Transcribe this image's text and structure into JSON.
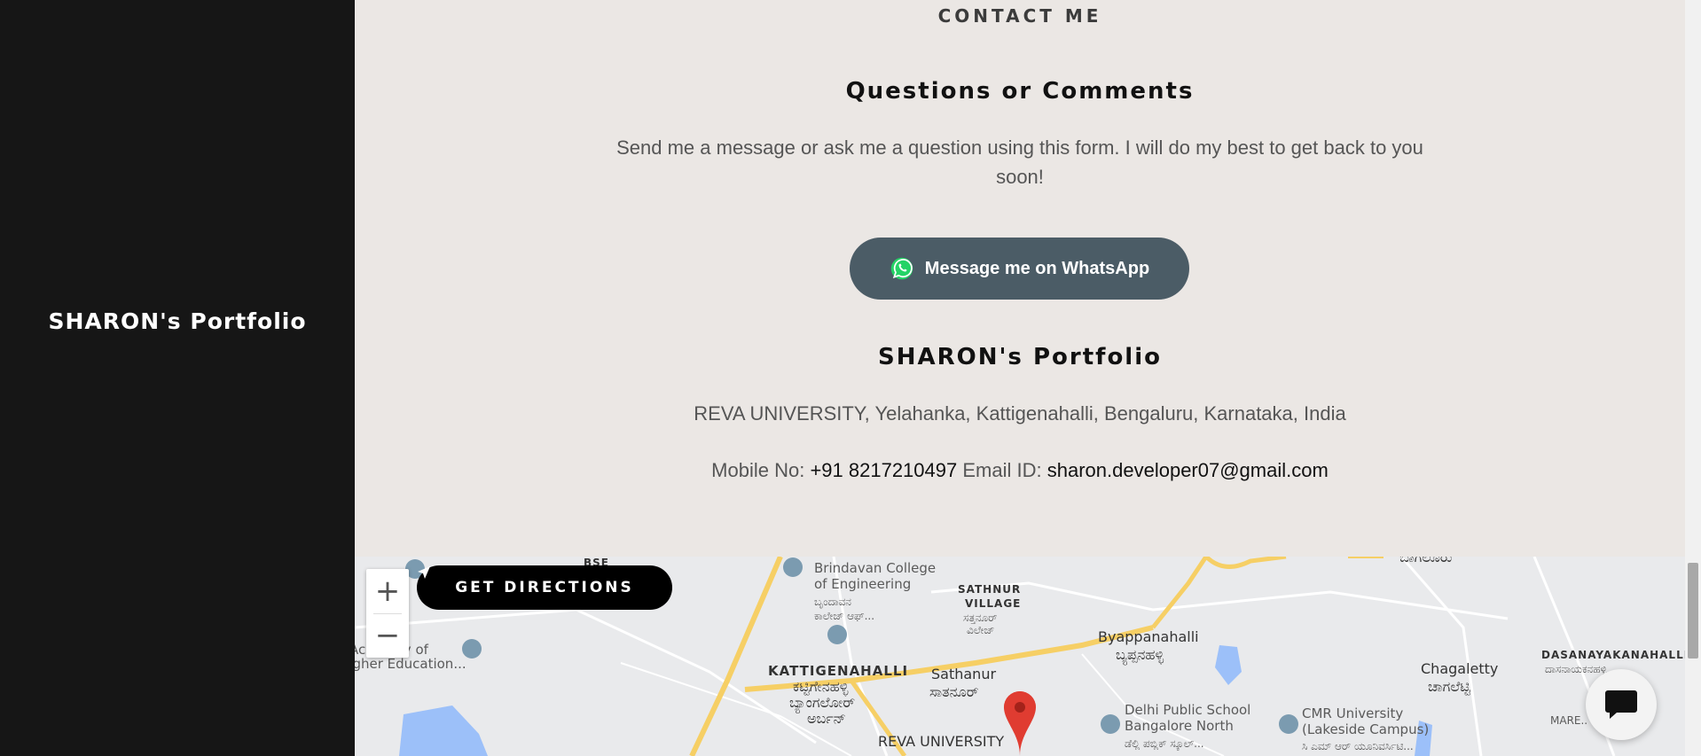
{
  "sidebar": {
    "brand": "SHARON's Portfolio"
  },
  "contact": {
    "section_label": "CONTACT ME",
    "heading": "Questions or Comments",
    "description": "Send me a message or ask me a question using this form. I will do my best to get back to you soon!",
    "whatsapp_label": "Message me on WhatsApp",
    "business_name": "SHARON's Portfolio",
    "address": "REVA UNIVERSITY, Yelahanka, Kattigenahalli, Bengaluru, Karnataka, India",
    "mobile_label": "Mobile No:",
    "mobile_value": "+91 8217210497",
    "email_label": "Email ID:",
    "email_value": "sharon.developer07@gmail.com"
  },
  "map": {
    "zoom_in": "+",
    "zoom_out": "−",
    "directions_label": "GET DIRECTIONS",
    "labels": {
      "bse": "BSE",
      "brindavan_1": "Brindavan College",
      "brindavan_2": "of Engineering",
      "brindavan_kn_1": "ಬೃಂದಾವನ",
      "brindavan_kn_2": "ಕಾಲೇಜ್ ಆಫ್...",
      "academy_1": "Academy of",
      "academy_2": "Higher Education...",
      "sathnur_village_1": "SATHNUR",
      "sathnur_village_2": "VILLAGE",
      "sathnur_village_kn_1": "ಸತ್ತನೂರ್",
      "sathnur_village_kn_2": "ವಿಲೇಜ್",
      "byappanahalli": "Byappanahalli",
      "byappanahalli_kn": "ಬ್ಯಪ್ಪನಹಳ್ಳಿ",
      "chagaletty": "Chagaletty",
      "chagaletty_kn": "ಚಾಗಲೆಟ್ಟಿ",
      "dasanayakanahalli": "DASANAYAKANAHALLI",
      "dasanayakanahalli_kn": "ದಾಸನಾಯಕನಹಳ್ಳಿ",
      "kattigenahalli": "KATTIGENAHALLI",
      "kattigenahalli_kn_1": "ಕಟ್ಟಿಗೇನಹಳ್ಳಿ",
      "kattigenahalli_kn_2": "ಬ್ಯಾಂಗಲೋರ್",
      "kattigenahalli_kn_3": "ಅರ್ಬನ್",
      "sathanur": "Sathanur",
      "sathanur_kn": "ಸಾತನೂರ್",
      "reva": "REVA UNIVERSITY",
      "dps_1": "Delhi Public School",
      "dps_2": "Bangalore North",
      "dps_kn": "ಡೆಲ್ಲಿ ಪಬ್ಲಿಕ್ ಸ್ಕೂಲ್...",
      "cmr_1": "CMR University",
      "cmr_2": "(Lakeside Campus)",
      "cmr_kn": "ಸಿ ಎಮ್ ಆರ್ ಯೂನಿವರ್ಸಿಟಿ...",
      "maren": "MARE..",
      "bagaluru": "ಬಾಗಲೂರು"
    }
  },
  "colors": {
    "sidebar_bg": "#161616",
    "main_bg": "#ebe7e4",
    "whatsapp_button_bg": "#4b5c66",
    "directions_button_bg": "#000000",
    "map_pin": "#e03c31",
    "road_yellow": "#f6cf65"
  }
}
